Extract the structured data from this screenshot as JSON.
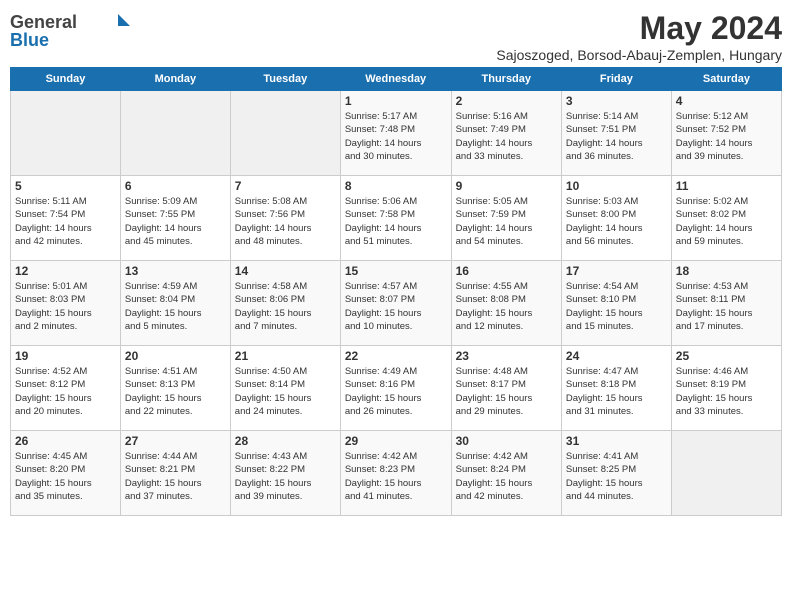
{
  "logo": {
    "general": "General",
    "blue": "Blue"
  },
  "title": "May 2024",
  "location": "Sajoszoged, Borsod-Abauj-Zemplen, Hungary",
  "weekdays": [
    "Sunday",
    "Monday",
    "Tuesday",
    "Wednesday",
    "Thursday",
    "Friday",
    "Saturday"
  ],
  "weeks": [
    [
      {
        "day": "",
        "info": ""
      },
      {
        "day": "",
        "info": ""
      },
      {
        "day": "",
        "info": ""
      },
      {
        "day": "1",
        "info": "Sunrise: 5:17 AM\nSunset: 7:48 PM\nDaylight: 14 hours\nand 30 minutes."
      },
      {
        "day": "2",
        "info": "Sunrise: 5:16 AM\nSunset: 7:49 PM\nDaylight: 14 hours\nand 33 minutes."
      },
      {
        "day": "3",
        "info": "Sunrise: 5:14 AM\nSunset: 7:51 PM\nDaylight: 14 hours\nand 36 minutes."
      },
      {
        "day": "4",
        "info": "Sunrise: 5:12 AM\nSunset: 7:52 PM\nDaylight: 14 hours\nand 39 minutes."
      }
    ],
    [
      {
        "day": "5",
        "info": "Sunrise: 5:11 AM\nSunset: 7:54 PM\nDaylight: 14 hours\nand 42 minutes."
      },
      {
        "day": "6",
        "info": "Sunrise: 5:09 AM\nSunset: 7:55 PM\nDaylight: 14 hours\nand 45 minutes."
      },
      {
        "day": "7",
        "info": "Sunrise: 5:08 AM\nSunset: 7:56 PM\nDaylight: 14 hours\nand 48 minutes."
      },
      {
        "day": "8",
        "info": "Sunrise: 5:06 AM\nSunset: 7:58 PM\nDaylight: 14 hours\nand 51 minutes."
      },
      {
        "day": "9",
        "info": "Sunrise: 5:05 AM\nSunset: 7:59 PM\nDaylight: 14 hours\nand 54 minutes."
      },
      {
        "day": "10",
        "info": "Sunrise: 5:03 AM\nSunset: 8:00 PM\nDaylight: 14 hours\nand 56 minutes."
      },
      {
        "day": "11",
        "info": "Sunrise: 5:02 AM\nSunset: 8:02 PM\nDaylight: 14 hours\nand 59 minutes."
      }
    ],
    [
      {
        "day": "12",
        "info": "Sunrise: 5:01 AM\nSunset: 8:03 PM\nDaylight: 15 hours\nand 2 minutes."
      },
      {
        "day": "13",
        "info": "Sunrise: 4:59 AM\nSunset: 8:04 PM\nDaylight: 15 hours\nand 5 minutes."
      },
      {
        "day": "14",
        "info": "Sunrise: 4:58 AM\nSunset: 8:06 PM\nDaylight: 15 hours\nand 7 minutes."
      },
      {
        "day": "15",
        "info": "Sunrise: 4:57 AM\nSunset: 8:07 PM\nDaylight: 15 hours\nand 10 minutes."
      },
      {
        "day": "16",
        "info": "Sunrise: 4:55 AM\nSunset: 8:08 PM\nDaylight: 15 hours\nand 12 minutes."
      },
      {
        "day": "17",
        "info": "Sunrise: 4:54 AM\nSunset: 8:10 PM\nDaylight: 15 hours\nand 15 minutes."
      },
      {
        "day": "18",
        "info": "Sunrise: 4:53 AM\nSunset: 8:11 PM\nDaylight: 15 hours\nand 17 minutes."
      }
    ],
    [
      {
        "day": "19",
        "info": "Sunrise: 4:52 AM\nSunset: 8:12 PM\nDaylight: 15 hours\nand 20 minutes."
      },
      {
        "day": "20",
        "info": "Sunrise: 4:51 AM\nSunset: 8:13 PM\nDaylight: 15 hours\nand 22 minutes."
      },
      {
        "day": "21",
        "info": "Sunrise: 4:50 AM\nSunset: 8:14 PM\nDaylight: 15 hours\nand 24 minutes."
      },
      {
        "day": "22",
        "info": "Sunrise: 4:49 AM\nSunset: 8:16 PM\nDaylight: 15 hours\nand 26 minutes."
      },
      {
        "day": "23",
        "info": "Sunrise: 4:48 AM\nSunset: 8:17 PM\nDaylight: 15 hours\nand 29 minutes."
      },
      {
        "day": "24",
        "info": "Sunrise: 4:47 AM\nSunset: 8:18 PM\nDaylight: 15 hours\nand 31 minutes."
      },
      {
        "day": "25",
        "info": "Sunrise: 4:46 AM\nSunset: 8:19 PM\nDaylight: 15 hours\nand 33 minutes."
      }
    ],
    [
      {
        "day": "26",
        "info": "Sunrise: 4:45 AM\nSunset: 8:20 PM\nDaylight: 15 hours\nand 35 minutes."
      },
      {
        "day": "27",
        "info": "Sunrise: 4:44 AM\nSunset: 8:21 PM\nDaylight: 15 hours\nand 37 minutes."
      },
      {
        "day": "28",
        "info": "Sunrise: 4:43 AM\nSunset: 8:22 PM\nDaylight: 15 hours\nand 39 minutes."
      },
      {
        "day": "29",
        "info": "Sunrise: 4:42 AM\nSunset: 8:23 PM\nDaylight: 15 hours\nand 41 minutes."
      },
      {
        "day": "30",
        "info": "Sunrise: 4:42 AM\nSunset: 8:24 PM\nDaylight: 15 hours\nand 42 minutes."
      },
      {
        "day": "31",
        "info": "Sunrise: 4:41 AM\nSunset: 8:25 PM\nDaylight: 15 hours\nand 44 minutes."
      },
      {
        "day": "",
        "info": ""
      }
    ]
  ]
}
